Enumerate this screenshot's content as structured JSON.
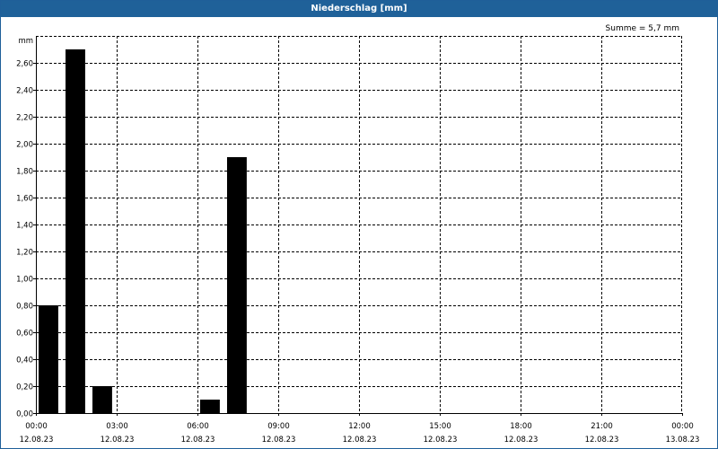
{
  "window": {
    "title": "Niederschlag [mm]",
    "summary": "Summe = 5,7 mm"
  },
  "chart_data": {
    "type": "bar",
    "ylabel": "mm",
    "ylim": [
      0,
      2.8
    ],
    "yticks": [
      0,
      0.2,
      0.4,
      0.6,
      0.8,
      1.0,
      1.2,
      1.4,
      1.6,
      1.8,
      2.0,
      2.2,
      2.4,
      2.6
    ],
    "ytick_labels": [
      "0,00",
      "0,20",
      "0,40",
      "0,60",
      "0,80",
      "1,00",
      "1,20",
      "1,40",
      "1,60",
      "1,80",
      "2,00",
      "2,20",
      "2,40",
      "2,60"
    ],
    "xlim_hours": [
      0,
      24
    ],
    "xticks": [
      {
        "hour": 0,
        "time": "00:00",
        "date": "12.08.23"
      },
      {
        "hour": 3,
        "time": "03:00",
        "date": "12.08.23"
      },
      {
        "hour": 6,
        "time": "06:00",
        "date": "12.08.23"
      },
      {
        "hour": 9,
        "time": "09:00",
        "date": "12.08.23"
      },
      {
        "hour": 12,
        "time": "12:00",
        "date": "12.08.23"
      },
      {
        "hour": 15,
        "time": "15:00",
        "date": "12.08.23"
      },
      {
        "hour": 18,
        "time": "18:00",
        "date": "12.08.23"
      },
      {
        "hour": 21,
        "time": "21:00",
        "date": "12.08.23"
      },
      {
        "hour": 24,
        "time": "00:00",
        "date": "13.08.23"
      }
    ],
    "bars": [
      {
        "hour": 0,
        "value": 0.8
      },
      {
        "hour": 1,
        "value": 2.7
      },
      {
        "hour": 2,
        "value": 0.2
      },
      {
        "hour": 6,
        "value": 0.1
      },
      {
        "hour": 7,
        "value": 1.9
      }
    ],
    "bar_color": "#000000",
    "grid": true
  }
}
